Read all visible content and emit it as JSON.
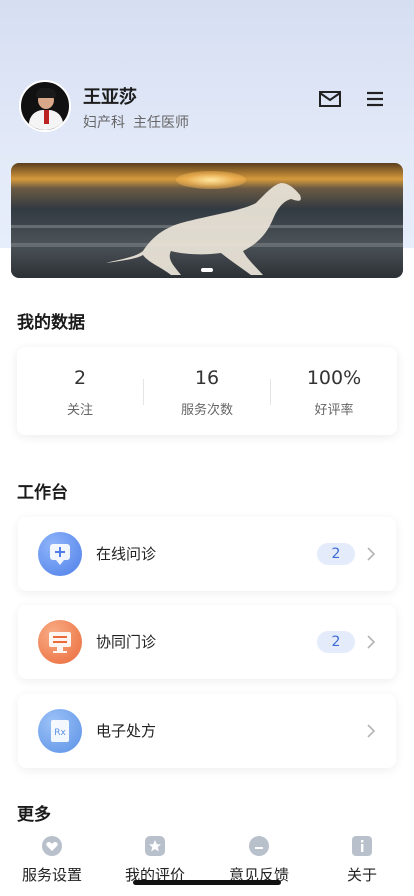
{
  "profile": {
    "name": "王亚莎",
    "department": "妇产科",
    "position": "主任医师"
  },
  "header_icons": {
    "mail": "mail-icon",
    "menu": "menu-icon"
  },
  "my_data": {
    "title": "我的数据",
    "stats": [
      {
        "value": "2",
        "label": "关注"
      },
      {
        "value": "16",
        "label": "服务次数"
      },
      {
        "value": "100%",
        "label": "好评率"
      }
    ]
  },
  "workbench": {
    "title": "工作台",
    "items": [
      {
        "label": "在线问诊",
        "badge": "2",
        "icon": "online-consult-icon",
        "color": "#5b8ef0"
      },
      {
        "label": "协同门诊",
        "badge": "2",
        "icon": "collab-clinic-icon",
        "color": "#f07f4a"
      },
      {
        "label": "电子处方",
        "badge": "",
        "icon": "prescription-icon",
        "color": "#6ea2ec"
      }
    ]
  },
  "more": {
    "title": "更多"
  },
  "tabbar": [
    {
      "label": "服务设置",
      "icon": "heart-icon"
    },
    {
      "label": "我的评价",
      "icon": "star-icon"
    },
    {
      "label": "意见反馈",
      "icon": "feedback-icon"
    },
    {
      "label": "关于",
      "icon": "info-icon"
    }
  ]
}
